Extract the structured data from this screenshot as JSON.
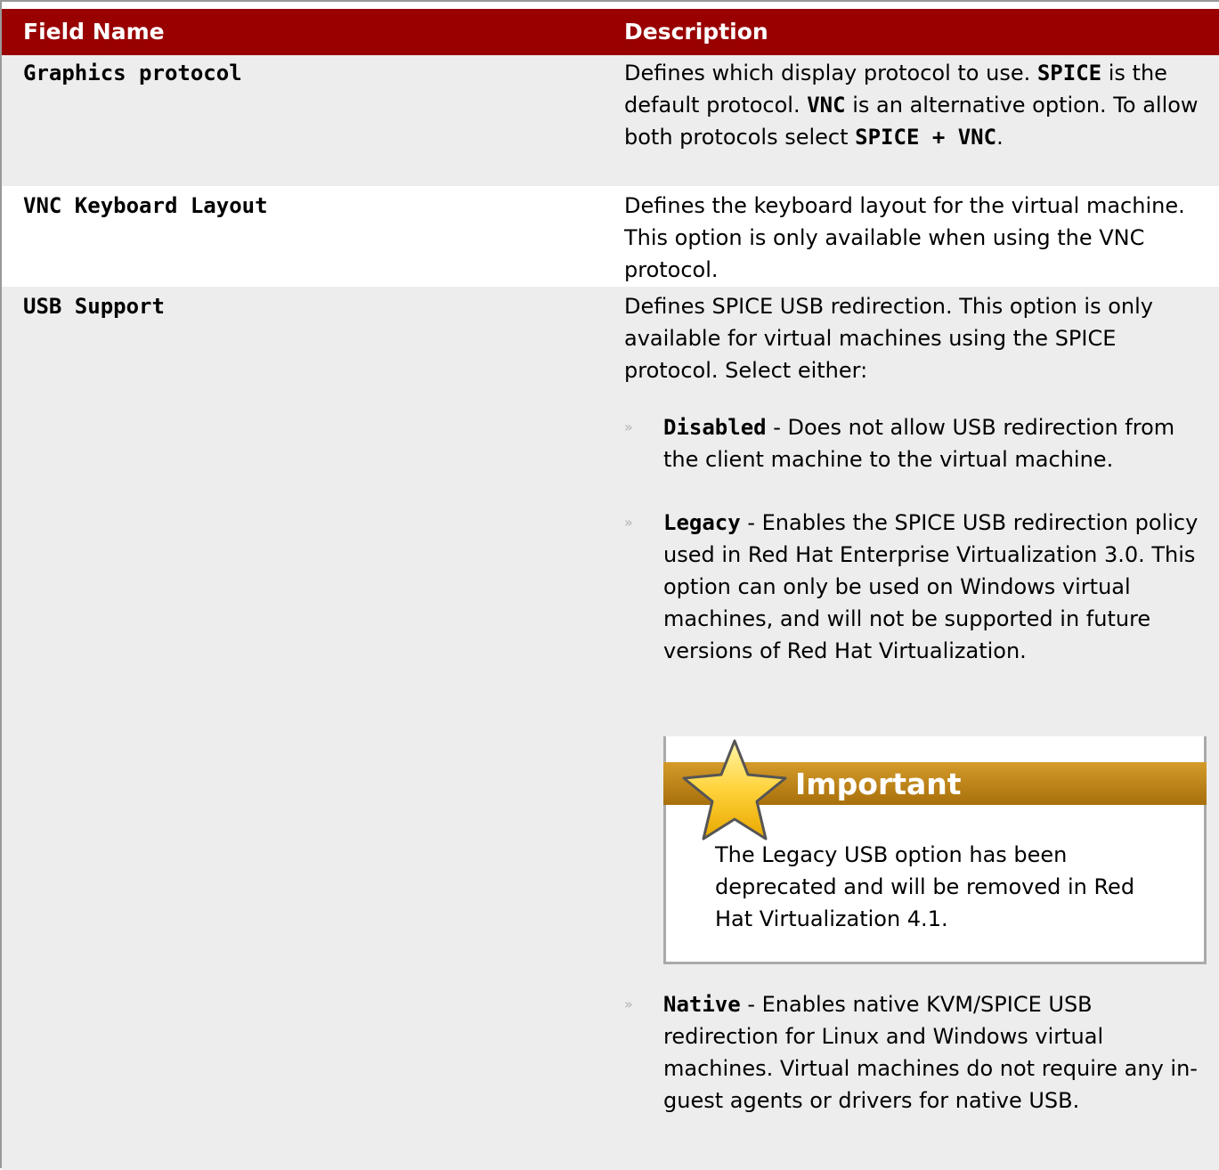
{
  "header": {
    "col_field": "Field Name",
    "col_desc": "Description"
  },
  "rows": [
    {
      "field": "Graphics protocol",
      "desc": {
        "t1": "Defines which display protocol to use. ",
        "b1": "SPICE",
        "t2": " is the default protocol. ",
        "b2": "VNC",
        "t3": " is an alternative option. To allow both protocols select ",
        "b3": "SPICE + VNC",
        "t4": "."
      }
    },
    {
      "field": "VNC Keyboard Layout",
      "desc": "Defines the keyboard layout for the virtual machine. This option is only available when using the VNC protocol."
    },
    {
      "field": "USB Support",
      "desc": "Defines SPICE USB redirection. This option is only available for virtual machines using the SPICE protocol. Select either:",
      "bullets": [
        {
          "term": "Disabled",
          "text": " - Does not allow USB redirection from the client machine to the virtual machine."
        },
        {
          "term": "Legacy",
          "text": " - Enables the SPICE USB redirection policy used in Red Hat Enterprise Virtualization 3.0. This option can only be used on Windows virtual machines, and will not be supported in future versions of Red Hat Virtualization."
        },
        {
          "term": "Native",
          "text": " - Enables native KVM/SPICE USB redirection for Linux and Windows virtual machines. Virtual machines do not require any in-guest agents or drivers for native USB."
        }
      ],
      "admonition": {
        "title": "Important",
        "icon": "star-icon",
        "text": "The Legacy USB option has been deprecated and will be removed in Red Hat Virtualization 4.1."
      }
    }
  ],
  "colors": {
    "header_bg": "#990000",
    "row_gray": "#ededed",
    "admonition_bar": "#c08418"
  }
}
